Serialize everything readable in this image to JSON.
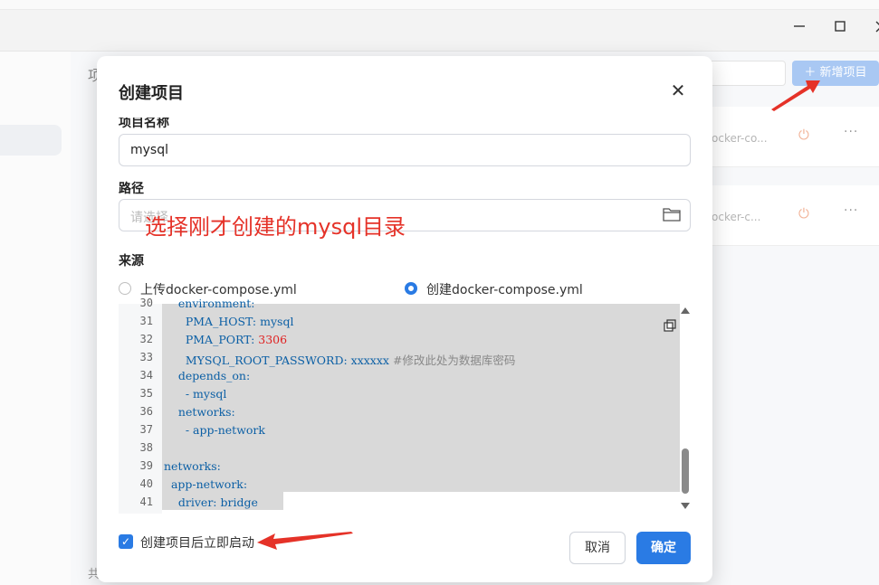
{
  "window": {
    "minimize_icon": "minimize-icon",
    "maximize_icon": "maximize-icon",
    "close_icon": "close-icon",
    "close_partial": "X"
  },
  "background": {
    "page_title_partial": "项",
    "add_button_label": "＋ 新增项目",
    "cards": [
      {
        "text": "ocker-co..."
      },
      {
        "text": "ocker-c..."
      }
    ],
    "footer_partial": "共"
  },
  "modal": {
    "title": "创建项目",
    "close_symbol": "✕",
    "name_label_partial": "项目名称",
    "name_value": "mysql",
    "path_label": "路径",
    "path_placeholder": "请选择",
    "source_label": "来源",
    "radio_options": [
      {
        "label": "上传docker-compose.yml",
        "selected": false
      },
      {
        "label": "创建docker-compose.yml",
        "selected": true
      }
    ],
    "code_lines": [
      {
        "num": "30",
        "text": "    environment:"
      },
      {
        "num": "31",
        "text": "      PMA_HOST: mysql"
      },
      {
        "num": "32",
        "key": "      PMA_PORT: ",
        "value": "3306"
      },
      {
        "num": "33",
        "key": "      MYSQL_ROOT_PASSWORD: xxxxxx ",
        "comment": "#修改此处为数据库密码"
      },
      {
        "num": "34",
        "text": "    depends_on:"
      },
      {
        "num": "35",
        "text": "      - mysql"
      },
      {
        "num": "36",
        "text": "    networks:"
      },
      {
        "num": "37",
        "text": "      - app-network"
      },
      {
        "num": "38",
        "text": ""
      },
      {
        "num": "39",
        "text": "networks:"
      },
      {
        "num": "40",
        "text": "  app-network:"
      },
      {
        "num": "41",
        "text": "    driver: bridge"
      }
    ],
    "autostart_label": "创建项目后立即启动",
    "autostart_checked": true,
    "cancel_label": "取消",
    "ok_label": "确定"
  },
  "annotation": {
    "text": "选择刚才创建的mysql目录",
    "color": "#e53228"
  },
  "colors": {
    "accent": "#2a7be4",
    "annotation_red": "#e53228"
  }
}
